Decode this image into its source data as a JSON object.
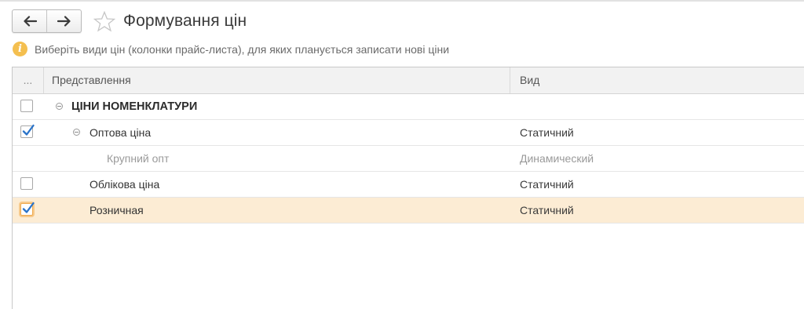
{
  "header": {
    "title": "Формування цін"
  },
  "hint": {
    "icon": "info-icon",
    "text": "Виберіть види цін (колонки прайс-листа), для яких планується записати нові ціни"
  },
  "table": {
    "columns": {
      "check": "...",
      "presentation": "Представлення",
      "type": "Вид"
    },
    "rows": [
      {
        "label": "ЦІНИ НОМЕНКЛАТУРИ",
        "type": "",
        "checked": false
      },
      {
        "label": "Оптова ціна",
        "type": "Статичний",
        "checked": true
      },
      {
        "label": "Крупний опт",
        "type": "Динамический",
        "checked": null
      },
      {
        "label": "Облікова ціна",
        "type": "Статичний",
        "checked": false
      },
      {
        "label": "Розничная",
        "type": "Статичний",
        "checked": true,
        "selected": true
      }
    ]
  },
  "colors": {
    "selected_row": "#fcecd4",
    "accent_check": "#2a73c9",
    "hint_icon": "#f4bf4f"
  }
}
